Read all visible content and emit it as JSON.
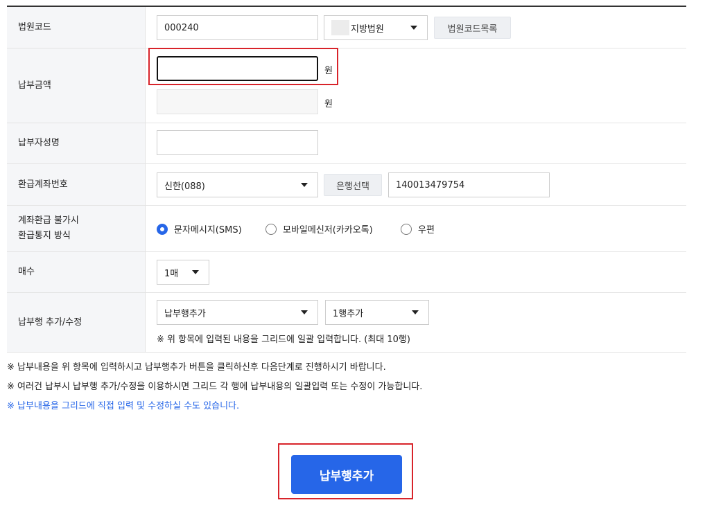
{
  "court_code": {
    "label": "법원코드",
    "value": "000240",
    "court_name": "지방법원",
    "list_button": "법원코드목록"
  },
  "payment_amount": {
    "label": "납부금액",
    "value": "",
    "unit": "원",
    "text_value": "",
    "text_unit": "원"
  },
  "payer_name": {
    "label": "납부자성명",
    "value": ""
  },
  "refund_account": {
    "label": "환급계좌번호",
    "bank": "신한(088)",
    "bank_button": "은행선택",
    "account_number": "140013479754"
  },
  "refund_notice": {
    "label_line1": "계좌환급 불가시",
    "label_line2": "환급통지 방식",
    "options": [
      "문자메시지(SMS)",
      "모바일메신저(카카오톡)",
      "우편"
    ],
    "selected": "문자메시지(SMS)"
  },
  "copies": {
    "label": "매수",
    "value": "1매"
  },
  "row_edit": {
    "label": "납부행 추가/수정",
    "action": "납부행추가",
    "count": "1행추가",
    "hint": "※ 위 항목에 입력된 내용을 그리드에 일괄 입력합니다. (최대 10행)"
  },
  "notes": [
    "※ 납부내용을 위 항목에 입력하시고 납부행추가 버튼을 클릭하신후 다음단계로 진행하시기 바랍니다.",
    "※ 여러건 납부시 납부행 추가/수정을 이용하시면 그리드 각 행에 납부내용의 일괄입력 또는 수정이 가능합니다.",
    "※ 납부내용을 그리드에 직접 입력 및 수정하실 수도 있습니다."
  ],
  "primary_button": "납부행추가",
  "colors": {
    "accent": "#2666e8",
    "highlight": "#d8232a",
    "header_bg": "#f5f6f8"
  }
}
